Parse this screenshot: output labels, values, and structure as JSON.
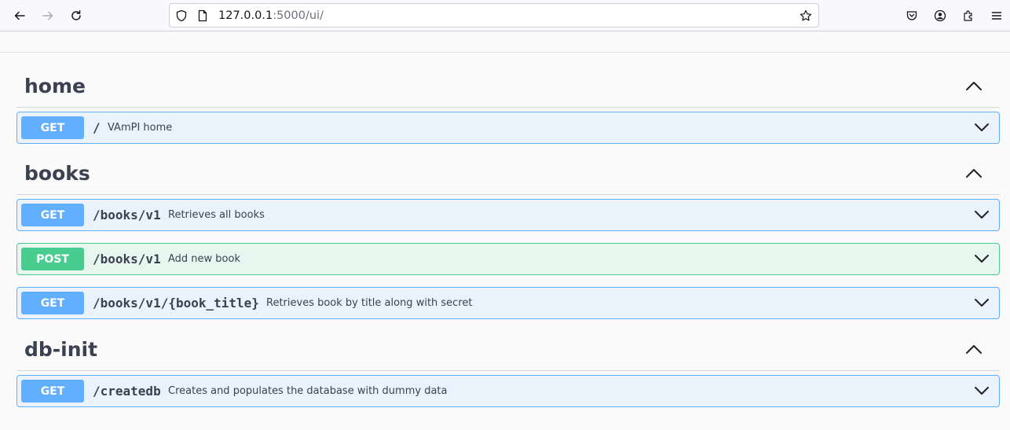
{
  "browser": {
    "url_host": "127.0.0.1",
    "url_rest": ":5000/ui/"
  },
  "sections": [
    {
      "title": "home",
      "operations": [
        {
          "method": "GET",
          "path": "/",
          "description": "VAmPI home"
        }
      ]
    },
    {
      "title": "books",
      "operations": [
        {
          "method": "GET",
          "path": "/books/v1",
          "description": "Retrieves all books"
        },
        {
          "method": "POST",
          "path": "/books/v1",
          "description": "Add new book"
        },
        {
          "method": "GET",
          "path": "/books/v1/{book_title}",
          "description": "Retrieves book by title along with secret"
        }
      ]
    },
    {
      "title": "db-init",
      "operations": [
        {
          "method": "GET",
          "path": "/createdb",
          "description": "Creates and populates the database with dummy data"
        }
      ]
    }
  ],
  "colors": {
    "get": "#61affe",
    "post": "#49cc90"
  }
}
